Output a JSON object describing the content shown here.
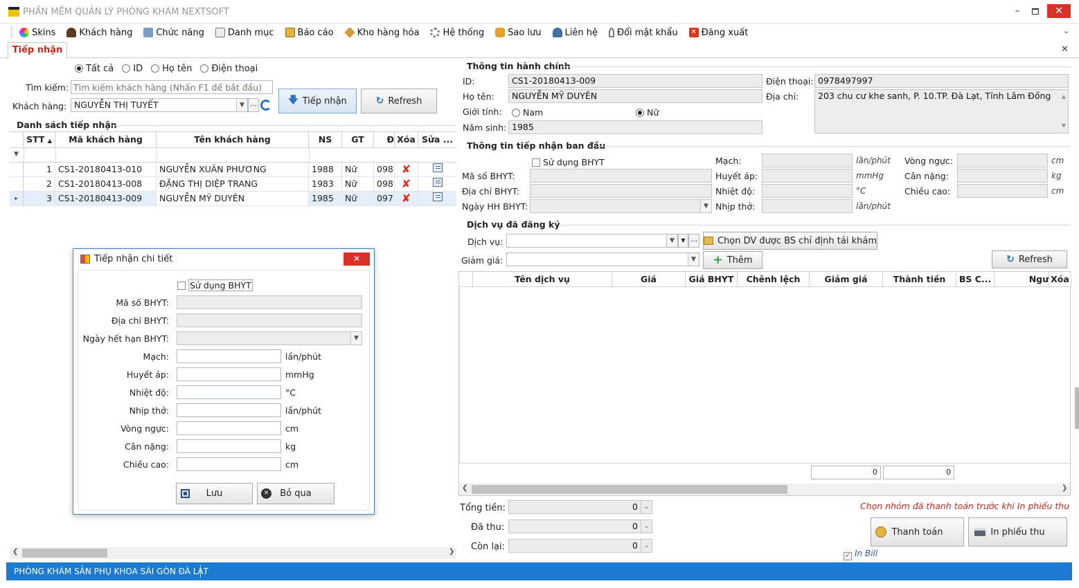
{
  "window": {
    "title": "PHẦN MỀM QUẢN LÝ PHÒNG KHÁM NEXTSOFT"
  },
  "menu": [
    {
      "label": "Skins",
      "icon": "palette-icon"
    },
    {
      "label": "Khách hàng",
      "icon": "user-icon"
    },
    {
      "label": "Chức năng",
      "icon": "function-icon"
    },
    {
      "label": "Danh mục",
      "icon": "catalog-icon"
    },
    {
      "label": "Báo cáo",
      "icon": "report-icon"
    },
    {
      "label": "Kho hàng hóa",
      "icon": "box-icon"
    },
    {
      "label": "Hệ thống",
      "icon": "gears-icon"
    },
    {
      "label": "Sao lưu",
      "icon": "database-icon"
    },
    {
      "label": "Liên hệ",
      "icon": "contact-icon"
    },
    {
      "label": "Đổi mật khẩu",
      "icon": "key-icon"
    },
    {
      "label": "Đăng xuất",
      "icon": "logout-icon"
    }
  ],
  "tab": {
    "label": "Tiếp nhận"
  },
  "left": {
    "filters": [
      "Tất cả",
      "ID",
      "Họ tên",
      "Điện thoại"
    ],
    "search_label": "Tìm kiếm:",
    "search_placeholder": "Tìm kiếm khách hàng (Nhấn F1 để bắt đầu)",
    "customer_label": "Khách hàng:",
    "customer_value": "NGUYỄN THỊ TUYẾT",
    "tiepnhan_btn": "Tiếp nhận",
    "refresh_btn": "Refresh",
    "list_title": "Danh sách tiếp nhận",
    "columns": [
      "STT",
      "Mã khách hàng",
      "Tên khách hàng",
      "NS",
      "GT",
      "Đ",
      "Xóa",
      "Sửa ..."
    ],
    "rows": [
      {
        "stt": "1",
        "ma": "CS1-20180413-010",
        "ten": "NGUYỄN XUÂN PHƯƠNG",
        "ns": "1988",
        "gt": "Nữ",
        "dt": "098"
      },
      {
        "stt": "2",
        "ma": "CS1-20180413-008",
        "ten": "ĐẶNG THỊ DIỆP TRANG",
        "ns": "1983",
        "gt": "Nữ",
        "dt": "098"
      },
      {
        "stt": "3",
        "ma": "CS1-20180413-009",
        "ten": "NGUYỄN MỸ DUYÊN",
        "ns": "1985",
        "gt": "Nữ",
        "dt": "097"
      }
    ]
  },
  "dialog": {
    "title": "Tiếp nhận chi tiết",
    "use_bhyt": "Sử dụng BHYT",
    "ma_so": "Mã số BHYT:",
    "dia_chi": "Địa chỉ BHYT:",
    "ngay_het_han": "Ngày hết hạn BHYT:",
    "mach": "Mạch:",
    "mach_unit": "lần/phút",
    "huyet_ap": "Huyết áp:",
    "huyet_ap_unit": "mmHg",
    "nhiet_do": "Nhiệt độ:",
    "nhiet_do_unit": "°C",
    "nhip_tho": "Nhịp thở:",
    "nhip_tho_unit": "lần/phút",
    "vong_nguc": "Vòng ngực:",
    "vong_nguc_unit": "cm",
    "can_nang": "Cân nặng:",
    "can_nang_unit": "kg",
    "chieu_cao": "Chiều cao:",
    "chieu_cao_unit": "cm",
    "save_btn": "Lưu",
    "skip_btn": "Bỏ qua"
  },
  "right": {
    "admin_title": "Thông tin hành chính",
    "id_label": "ID:",
    "id_value": "CS1-20180413-009",
    "phone_label": "Điện thoại:",
    "phone_value": "0978497997",
    "name_label": "Họ tên:",
    "name_value": "NGUYỄN MỸ DUYÊN",
    "addr_label": "Địa chỉ:",
    "addr_value": "203 chu cư khe sanh, P. 10.TP. Đà Lạt, Tỉnh Lâm Đồng",
    "gender_label": "Giới tính:",
    "gender_male": "Nam",
    "gender_female": "Nữ",
    "birth_label": "Năm sinh:",
    "birth_value": "1985",
    "init_title": "Thông tin tiếp nhận ban đầu",
    "use_bhyt": "Sử dụng BHYT",
    "ma_so": "Mã số BHYT:",
    "dia_chi": "Địa chỉ BHYT:",
    "ngay_hh": "Ngày HH BHYT:",
    "mach": "Mạch:",
    "mach_unit": "lần/phút",
    "huyet_ap": "Huyết áp:",
    "huyet_ap_unit": "mmHg",
    "nhiet_do": "Nhiệt độ:",
    "nhiet_do_unit": "°C",
    "nhip_tho": "Nhịp thở:",
    "nhip_tho_unit": "lần/phút",
    "vong_nguc": "Vòng ngực:",
    "vong_nguc_unit": "cm",
    "can_nang": "Cân nặng:",
    "can_nang_unit": "kg",
    "chieu_cao": "Chiều cao:",
    "chieu_cao_unit": "cm",
    "svc_title": "Dịch vụ đã đăng ký",
    "svc_label": "Dịch vụ:",
    "choose_btn": "Chọn DV được BS chỉ định tái khám",
    "discount_label": "Giảm giá:",
    "add_btn": "Thêm",
    "refresh_btn": "Refresh",
    "svc_columns": [
      "Tên dịch vụ",
      "Giá",
      "Giá BHYT",
      "Chênh lệch",
      "Giảm giá",
      "Thành tiền",
      "BS C...",
      "Ngư",
      "Xóa"
    ],
    "sum1": "0",
    "sum2": "0",
    "total_label": "Tổng tiền:",
    "total_value": "0",
    "paid_label": "Đã thu:",
    "paid_value": "0",
    "remain_label": "Còn lại:",
    "remain_value": "0",
    "note": "Chọn nhóm đã thanh toán trước khi In phiếu thu",
    "pay_btn": "Thanh toán",
    "print_btn": "In phiếu thu",
    "inbill": "In Bill"
  },
  "status": {
    "text": "PHÒNG KHÁM SẢN PHỤ KHOA SÀI GÒN ĐÀ LẠT"
  }
}
